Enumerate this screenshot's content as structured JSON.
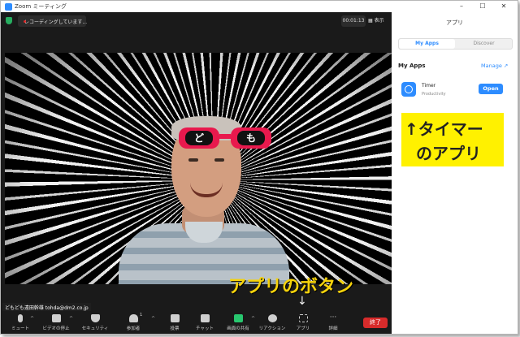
{
  "window": {
    "title": "Zoom ミーティング",
    "minimize": "–",
    "maximize": "☐",
    "close": "✕"
  },
  "topbar": {
    "recording_text": "レコーディングしています...",
    "elapsed": "00:01:13",
    "view_label": "表示"
  },
  "video": {
    "glasses_left": "ど",
    "glasses_right": "も",
    "caption": "アプリのボタン",
    "arrow": "↓",
    "name_label": "どもども遠田幹雄 tohda@dm2.co.jp"
  },
  "toolbar": {
    "mute": "ミュート",
    "video_stop": "ビデオの停止",
    "security": "セキュリティ",
    "participants": "参加者",
    "participants_count": "1",
    "polls": "投票",
    "chat": "チャット",
    "share": "画面の共有",
    "reactions": "リアクション",
    "apps": "アプリ",
    "more": "詳細",
    "more_glyph": "···",
    "caret": "^",
    "end": "終了"
  },
  "panel": {
    "title": "アプリ",
    "tab_my_apps": "My Apps",
    "tab_discover": "Discover",
    "section_title": "My Apps",
    "manage": "Manage ↗",
    "app": {
      "name": "Timer",
      "category": "Productivity",
      "open": "Open"
    },
    "note_line1": "↑タイマー",
    "note_line2": "のアプリ"
  },
  "colors": {
    "accent": "#2d8cff",
    "end_red": "#d72b2b",
    "caption_yellow": "#f5d20b",
    "note_yellow": "#fff100"
  }
}
